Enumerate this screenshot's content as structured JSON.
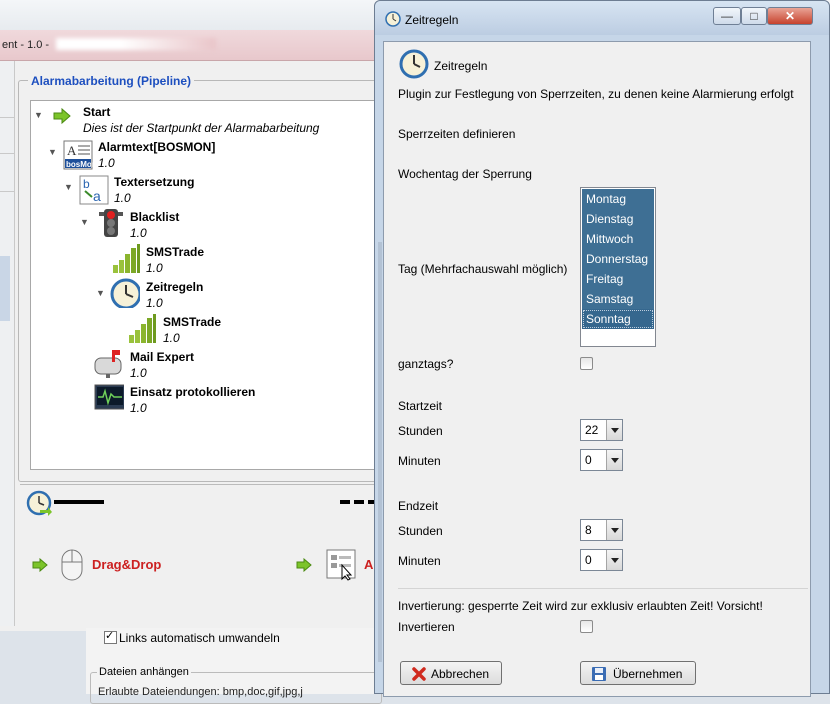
{
  "background_window": {
    "title": "ent - 1.0 -",
    "pipeline_title": "Alarmabarbeitung (Pipeline)",
    "tree": [
      {
        "name": "Start",
        "version": "Dies ist der Startpunkt der Alarmabarbeitung",
        "icon": "green-arrow-icon"
      },
      {
        "name": "Alarmtext[BOSMON]",
        "version": "1.0",
        "icon": "bosmon-text-icon"
      },
      {
        "name": "Textersetzung",
        "version": "1.0",
        "icon": "text-replace-icon"
      },
      {
        "name": "Blacklist",
        "version": "1.0",
        "icon": "traffic-light-icon"
      },
      {
        "name": "SMSTrade",
        "version": "1.0",
        "icon": "signal-bars-icon"
      },
      {
        "name": "Zeitregeln",
        "version": "1.0",
        "icon": "clock-icon"
      },
      {
        "name": "SMSTrade",
        "version": "1.0",
        "icon": "signal-bars-icon"
      },
      {
        "name": "Mail Expert",
        "version": "1.0",
        "icon": "mailbox-icon"
      },
      {
        "name": "Einsatz protokollieren",
        "version": "1.0",
        "icon": "monitor-log-icon"
      }
    ],
    "dragdrop_label": "Drag&Drop",
    "partial_label": "A",
    "links_label": "Links automatisch umwandeln",
    "files_legend": "Dateien anhängen",
    "files_text": "Erlaubte Dateiendungen: bmp,doc,gif,jpg,j"
  },
  "dialog": {
    "title": "Zeitregeln",
    "window_buttons": {
      "minimize": "—",
      "maximize": "□",
      "close": "✕"
    },
    "header_title": "Zeitregeln",
    "description": "Plugin zur Festlegung von Sperrzeiten, zu denen keine Alarmierung erfolgt",
    "section_define": "Sperrzeiten definieren",
    "weekday_label": "Wochentag der Sperrung",
    "day_label": "Tag (Mehrfachauswahl möglich)",
    "days": [
      "Montag",
      "Dienstag",
      "Mittwoch",
      "Donnerstag",
      "Freitag",
      "Samstag",
      "Sonntag"
    ],
    "allday_label": "ganztags?",
    "start_label": "Startzeit",
    "start_hours_label": "Stunden",
    "start_hours_value": "22",
    "start_minutes_label": "Minuten",
    "start_minutes_value": "0",
    "end_label": "Endzeit",
    "end_hours_label": "Stunden",
    "end_hours_value": "8",
    "end_minutes_label": "Minuten",
    "end_minutes_value": "0",
    "invert_note": "Invertierung: gesperrte Zeit wird zur exklusiv erlaubten Zeit! Vorsicht!",
    "invert_label": "Invertieren",
    "cancel_label": "Abbrechen",
    "apply_label": "Übernehmen",
    "selection_color": "#3e6f94",
    "accent_red": "#cc2020",
    "link_blue": "#1d4fbf"
  }
}
